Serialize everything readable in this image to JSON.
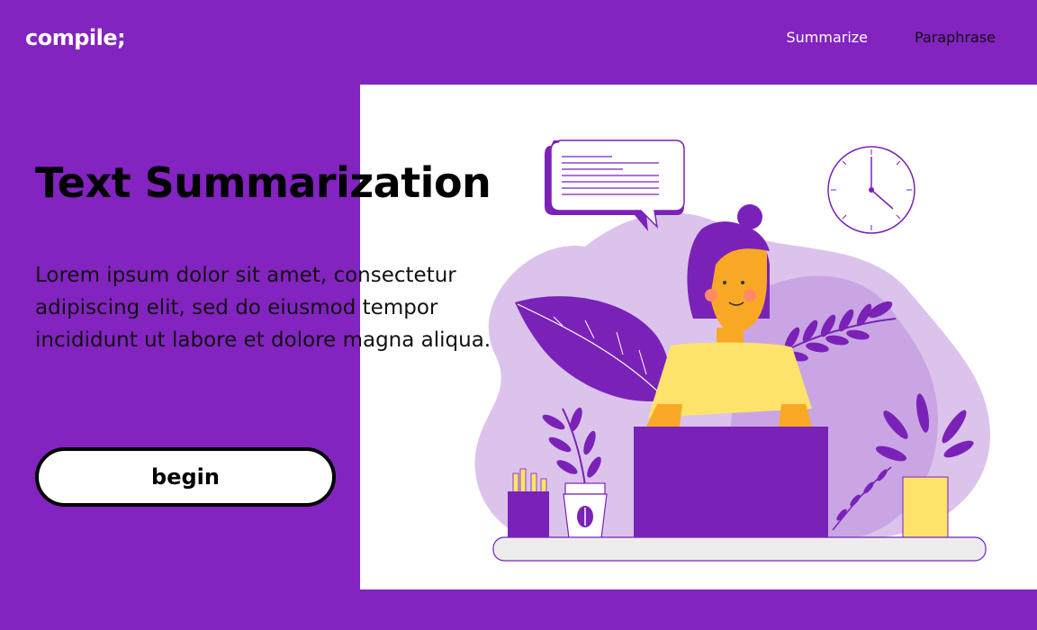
{
  "brand": {
    "logo": "compile;"
  },
  "nav": {
    "items": [
      {
        "label": "Summarize"
      },
      {
        "label": "Paraphrase"
      }
    ]
  },
  "hero": {
    "title": "Text Summarization",
    "description": "Lorem ipsum dolor sit amet, consectetur adipiscing elit, sed do eiusmod tempor incididunt ut labore et dolore magna aliqua.",
    "button_label": "begin"
  },
  "colors": {
    "background": "#8323c0",
    "panel": "#ffffff",
    "accent_purple": "#7a22b8",
    "light_purple": "#dcc3ec",
    "mid_purple": "#c9a6e3",
    "yellow": "#fde36b",
    "skin": "#f9a825"
  },
  "illustration": {
    "icons": [
      "speech-bubble-icon",
      "wall-clock-icon",
      "woman-at-laptop-illustration",
      "pencil-cup-icon",
      "coffee-cup-icon",
      "potted-plant-icon",
      "leaf-icon"
    ]
  }
}
